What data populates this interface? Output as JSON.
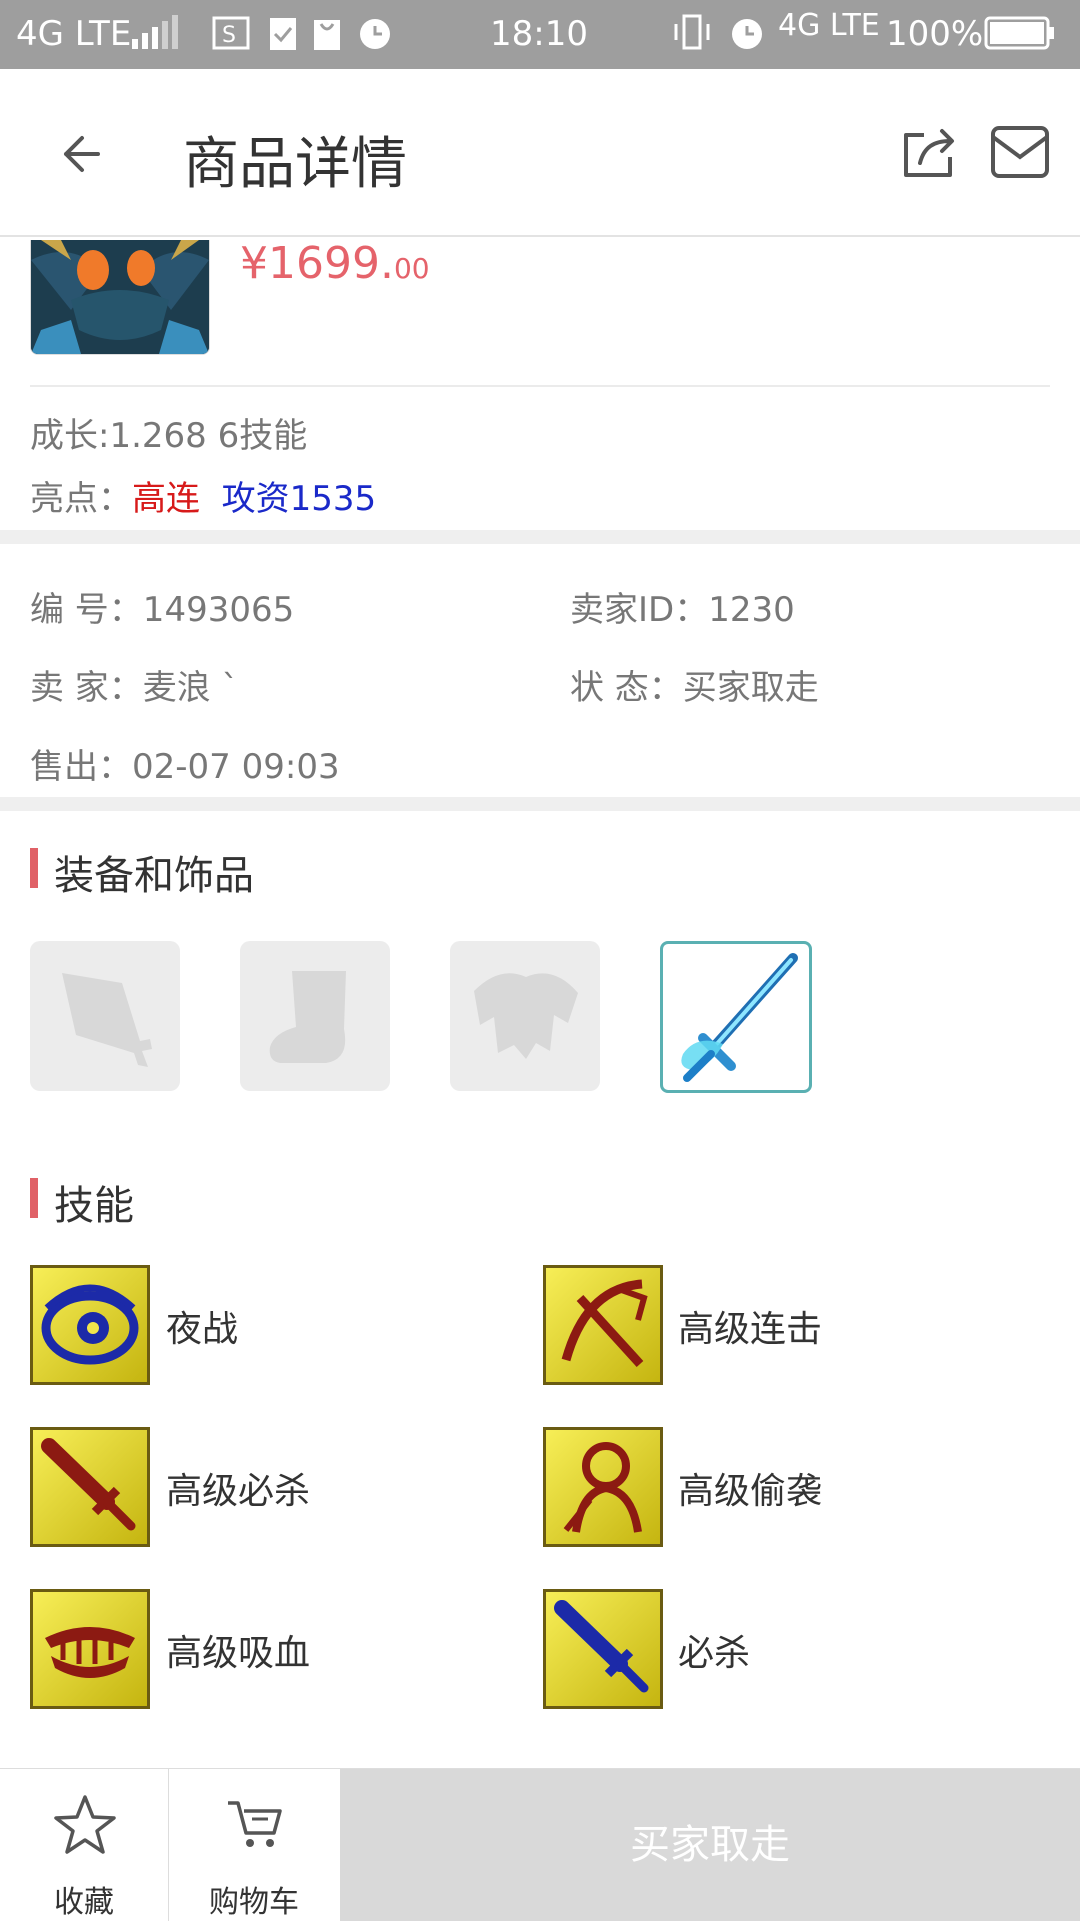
{
  "status_bar": {
    "network_left": "4G LTE",
    "time": "18:10",
    "network_right": "4G LTE",
    "battery": "100%"
  },
  "header": {
    "title": "商品详情"
  },
  "product": {
    "price_main": "¥1699.",
    "price_cents": "00",
    "growth": "成长:1.268 6技能",
    "highlight_label": "亮点：",
    "highlight_red": "高连",
    "highlight_blue": "攻资1535"
  },
  "details": {
    "number": "编  号：1493065",
    "seller_id": "卖家ID：1230",
    "seller": "卖  家：麦浪 `",
    "status": "状  态：买家取走",
    "sold": "售出：02-07 09:03"
  },
  "equipment": {
    "title": "装备和饰品",
    "slots": [
      "weapon-slot-icon",
      "boots-slot-icon",
      "armor-slot-icon",
      "ice-sword-item"
    ]
  },
  "skills": {
    "title": "技能",
    "items": [
      "夜战",
      "高级连击",
      "高级必杀",
      "高级偷袭",
      "高级吸血",
      "必杀"
    ]
  },
  "bottom_bar": {
    "favorite": "收藏",
    "cart": "购物车",
    "buy": "买家取走"
  },
  "colors": {
    "price": "#e5636b",
    "accent_mark": "#e06167",
    "highlight_red": "#d71a1a",
    "highlight_blue": "#1a29c9",
    "status_bar": "#9e9e9e"
  }
}
